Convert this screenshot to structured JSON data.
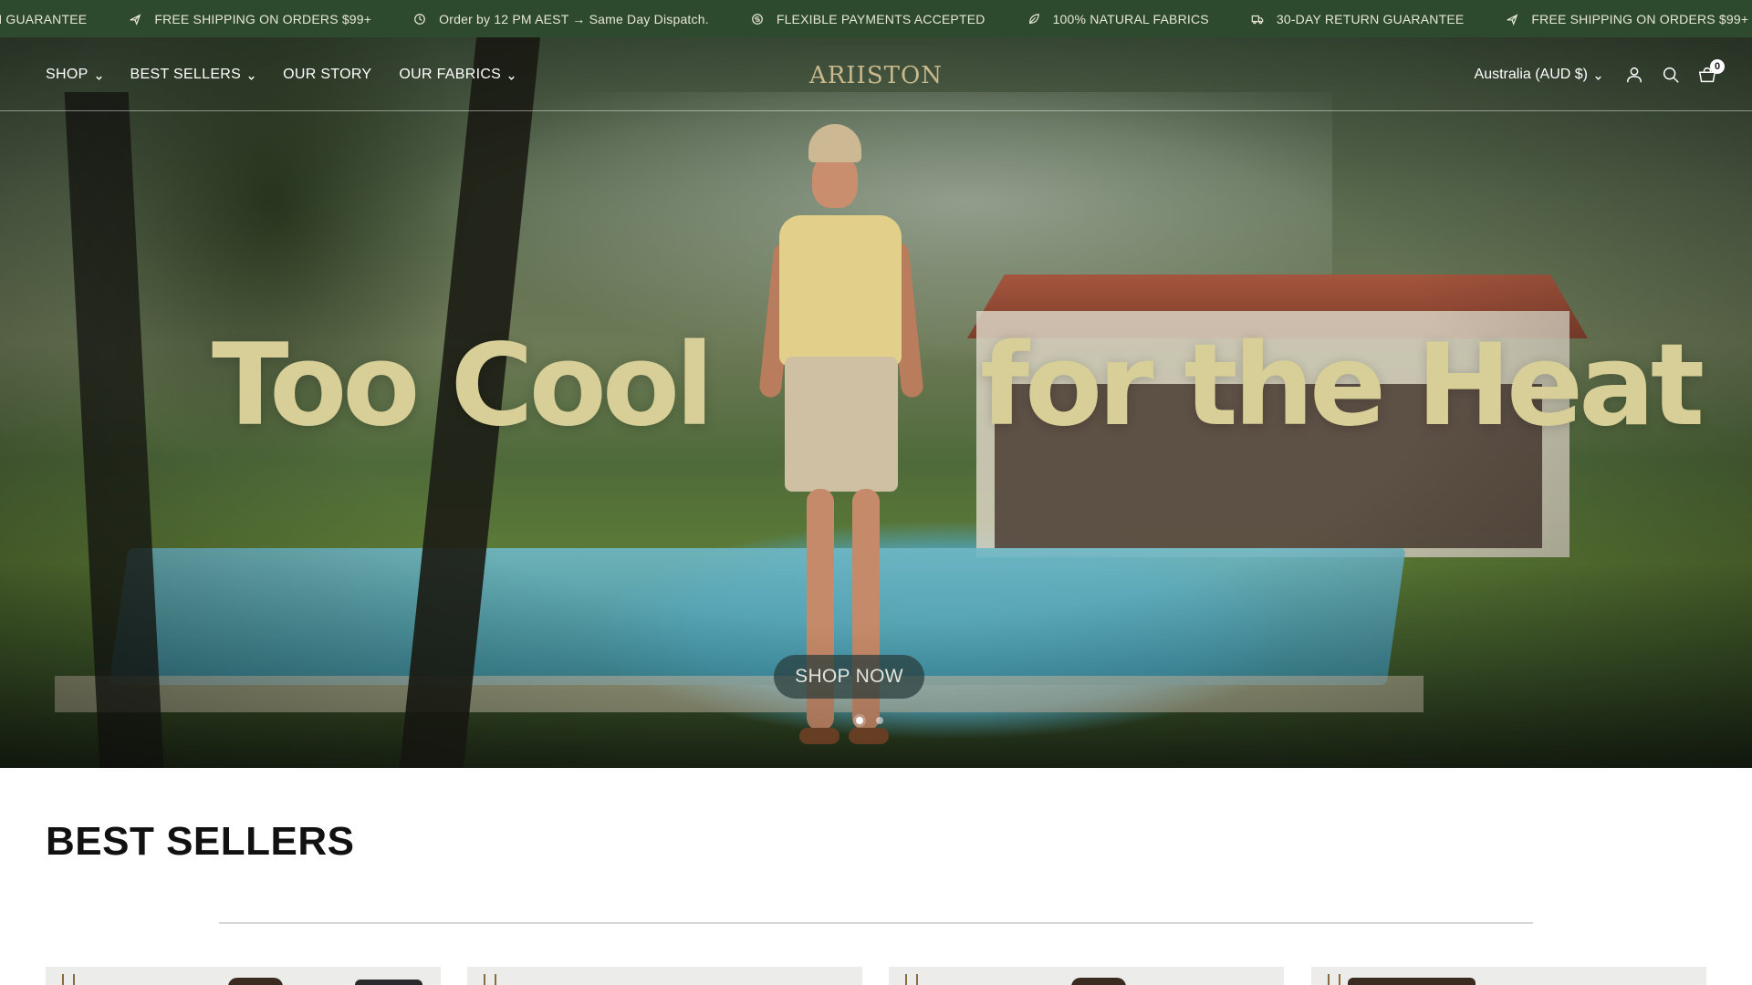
{
  "announcement_bar": {
    "items": [
      {
        "icon": "shield-icon",
        "text": "N GUARANTEE"
      },
      {
        "icon": "plane-icon",
        "text": "FREE SHIPPING ON ORDERS $99+"
      },
      {
        "icon": "clock-icon",
        "text": "Order by 12 PM AEST → Same Day Dispatch."
      },
      {
        "icon": "coin-icon",
        "text": "FLEXIBLE PAYMENTS ACCEPTED"
      },
      {
        "icon": "leaf-icon",
        "text": "100% NATURAL FABRICS"
      },
      {
        "icon": "truck-icon",
        "text": "30-DAY RETURN GUARANTEE"
      },
      {
        "icon": "plane-icon",
        "text": "FREE SHIPPING ON ORDERS $99+"
      }
    ],
    "colors": {
      "background": "#2d4a2f",
      "text": "#e8e6d4"
    }
  },
  "header": {
    "nav": [
      {
        "label": "SHOP",
        "has_dropdown": true
      },
      {
        "label": "BEST SELLERS",
        "has_dropdown": true
      },
      {
        "label": "OUR STORY",
        "has_dropdown": false
      },
      {
        "label": "OUR FABRICS",
        "has_dropdown": true
      }
    ],
    "logo": "ARIISTON",
    "country_selector": "Australia (AUD $)",
    "icons": [
      "account-icon",
      "search-icon",
      "cart-icon"
    ],
    "cart_count": "0"
  },
  "hero": {
    "headline_left": "Too Cool",
    "headline_right": "for the Heat",
    "cta_label": "SHOP NOW",
    "slides": 2,
    "active_slide": 1,
    "colors": {
      "headline": "#d8cf98"
    }
  },
  "best_sellers": {
    "title": "BEST SELLERS",
    "cards_visible": 4
  }
}
